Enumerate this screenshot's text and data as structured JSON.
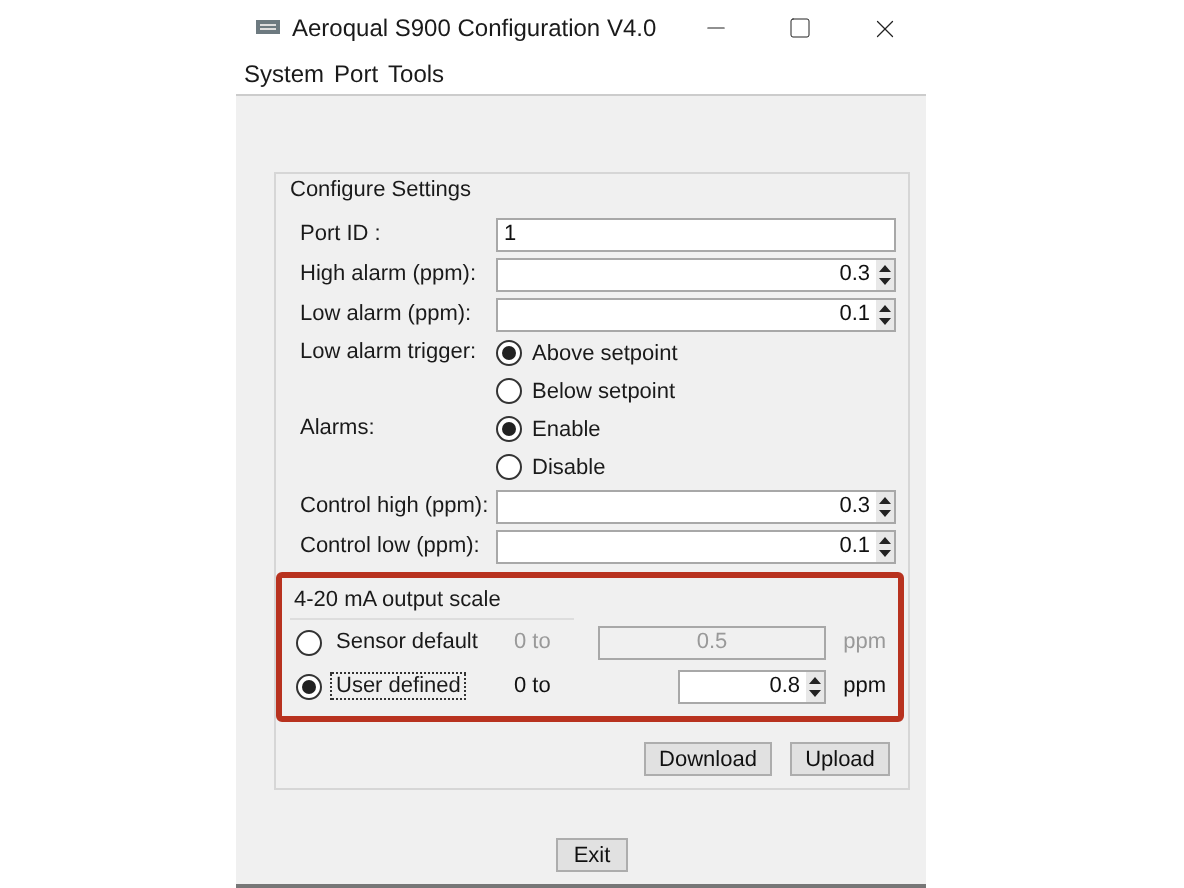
{
  "window": {
    "title": "Aeroqual S900 Configuration V4.0"
  },
  "menu": [
    "System",
    "Port",
    "Tools"
  ],
  "settings": {
    "title": "Configure Settings",
    "rows": [
      {
        "kind": "text",
        "label": "Port ID :",
        "value": "1"
      },
      {
        "kind": "spinner",
        "label": "High alarm (ppm):",
        "value": "0.3"
      },
      {
        "kind": "spinner",
        "label": "Low alarm (ppm):",
        "value": "0.1"
      },
      {
        "kind": "radio",
        "label": "Low alarm trigger:",
        "options": [
          {
            "label": "Above setpoint",
            "selected": true
          },
          {
            "label": "Below setpoint",
            "selected": false
          }
        ]
      },
      {
        "kind": "radio",
        "label": "Alarms:",
        "options": [
          {
            "label": "Enable",
            "selected": true
          },
          {
            "label": "Disable",
            "selected": false
          }
        ]
      },
      {
        "kind": "spinner",
        "label": "Control high (ppm):",
        "value": "0.3"
      },
      {
        "kind": "spinner",
        "label": "Control low (ppm):",
        "value": "0.1"
      }
    ]
  },
  "output_scale": {
    "title": "4-20 mA output scale",
    "highlighted": true,
    "options": [
      {
        "label": "Sensor default",
        "selected": false,
        "focused": false,
        "disabled": true,
        "kind": "text",
        "prefix": "0 to",
        "value": "0.5",
        "unit": "ppm"
      },
      {
        "label": "User defined",
        "selected": true,
        "focused": true,
        "disabled": false,
        "kind": "spinner",
        "prefix": "0 to",
        "value": "0.8",
        "unit": "ppm"
      }
    ]
  },
  "actions": [
    "Download",
    "Upload"
  ],
  "footer_button": "Exit"
}
